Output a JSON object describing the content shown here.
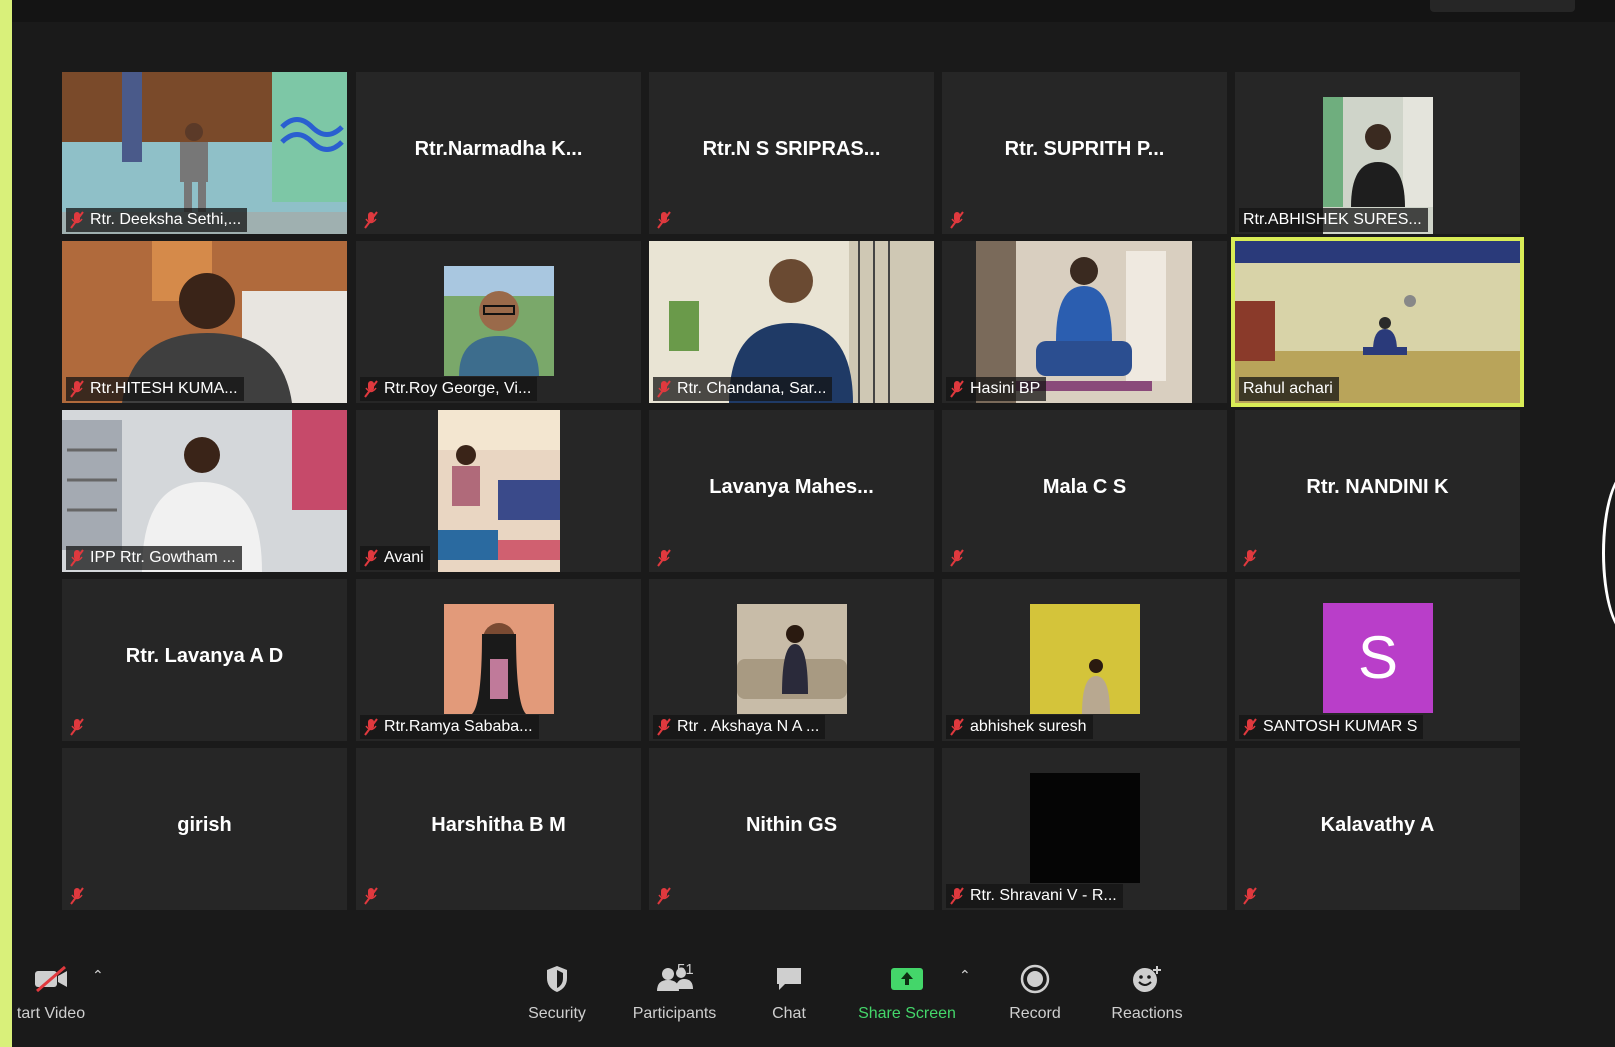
{
  "participants": [
    {
      "name": "Rtr. Deeksha Sethi,...",
      "label": "Rtr. Deeksha Sethi,..."
    },
    {
      "name": "Rtr.Narmadha  K...",
      "label": ""
    },
    {
      "name": "Rtr.N  S  SRIPRAS...",
      "label": ""
    },
    {
      "name": "Rtr.  SUPRITH  P...",
      "label": ""
    },
    {
      "name": "Rtr.ABHISHEK SURES...",
      "label": "Rtr.ABHISHEK SURES..."
    },
    {
      "name": "Rtr.HITESH KUMA...",
      "label": "Rtr.HITESH KUMA..."
    },
    {
      "name": "Rtr.Roy George, Vi...",
      "label": "Rtr.Roy George, Vi..."
    },
    {
      "name": "Rtr. Chandana, Sar...",
      "label": "Rtr. Chandana, Sar..."
    },
    {
      "name": "Hasini BP",
      "label": "Hasini BP"
    },
    {
      "name": "Rahul achari",
      "label": "Rahul achari"
    },
    {
      "name": "IPP Rtr. Gowtham ...",
      "label": "IPP Rtr. Gowtham ..."
    },
    {
      "name": "Avani",
      "label": "Avani"
    },
    {
      "name": "Lavanya  Mahes...",
      "label": ""
    },
    {
      "name": "Mala C S",
      "label": ""
    },
    {
      "name": "Rtr. NANDINI K",
      "label": ""
    },
    {
      "name": "Rtr. Lavanya A D",
      "label": ""
    },
    {
      "name": "Rtr.Ramya Sababa...",
      "label": "Rtr.Ramya Sababa..."
    },
    {
      "name": "Rtr . Akshaya N A ...",
      "label": "Rtr . Akshaya N A ..."
    },
    {
      "name": "abhishek suresh",
      "label": "abhishek suresh"
    },
    {
      "name": "SANTOSH KUMAR S",
      "label": "SANTOSH KUMAR S",
      "initial": "S"
    },
    {
      "name": "girish",
      "label": ""
    },
    {
      "name": "Harshitha B M",
      "label": ""
    },
    {
      "name": "Nithin GS",
      "label": ""
    },
    {
      "name": "Rtr. Shravani V - R...",
      "label": "Rtr. Shravani V - R..."
    },
    {
      "name": "Kalavathy A",
      "label": ""
    }
  ],
  "toolbar": {
    "video_label": "tart Video",
    "security_label": "Security",
    "participants_label": "Participants",
    "participants_count": "51",
    "chat_label": "Chat",
    "share_label": "Share Screen",
    "record_label": "Record",
    "reactions_label": "Reactions"
  },
  "colors": {
    "active_speaker": "#d9ec56",
    "share_green": "#44d66a",
    "avatar_purple": "#b93ec9",
    "mute_red": "#e0393e"
  }
}
